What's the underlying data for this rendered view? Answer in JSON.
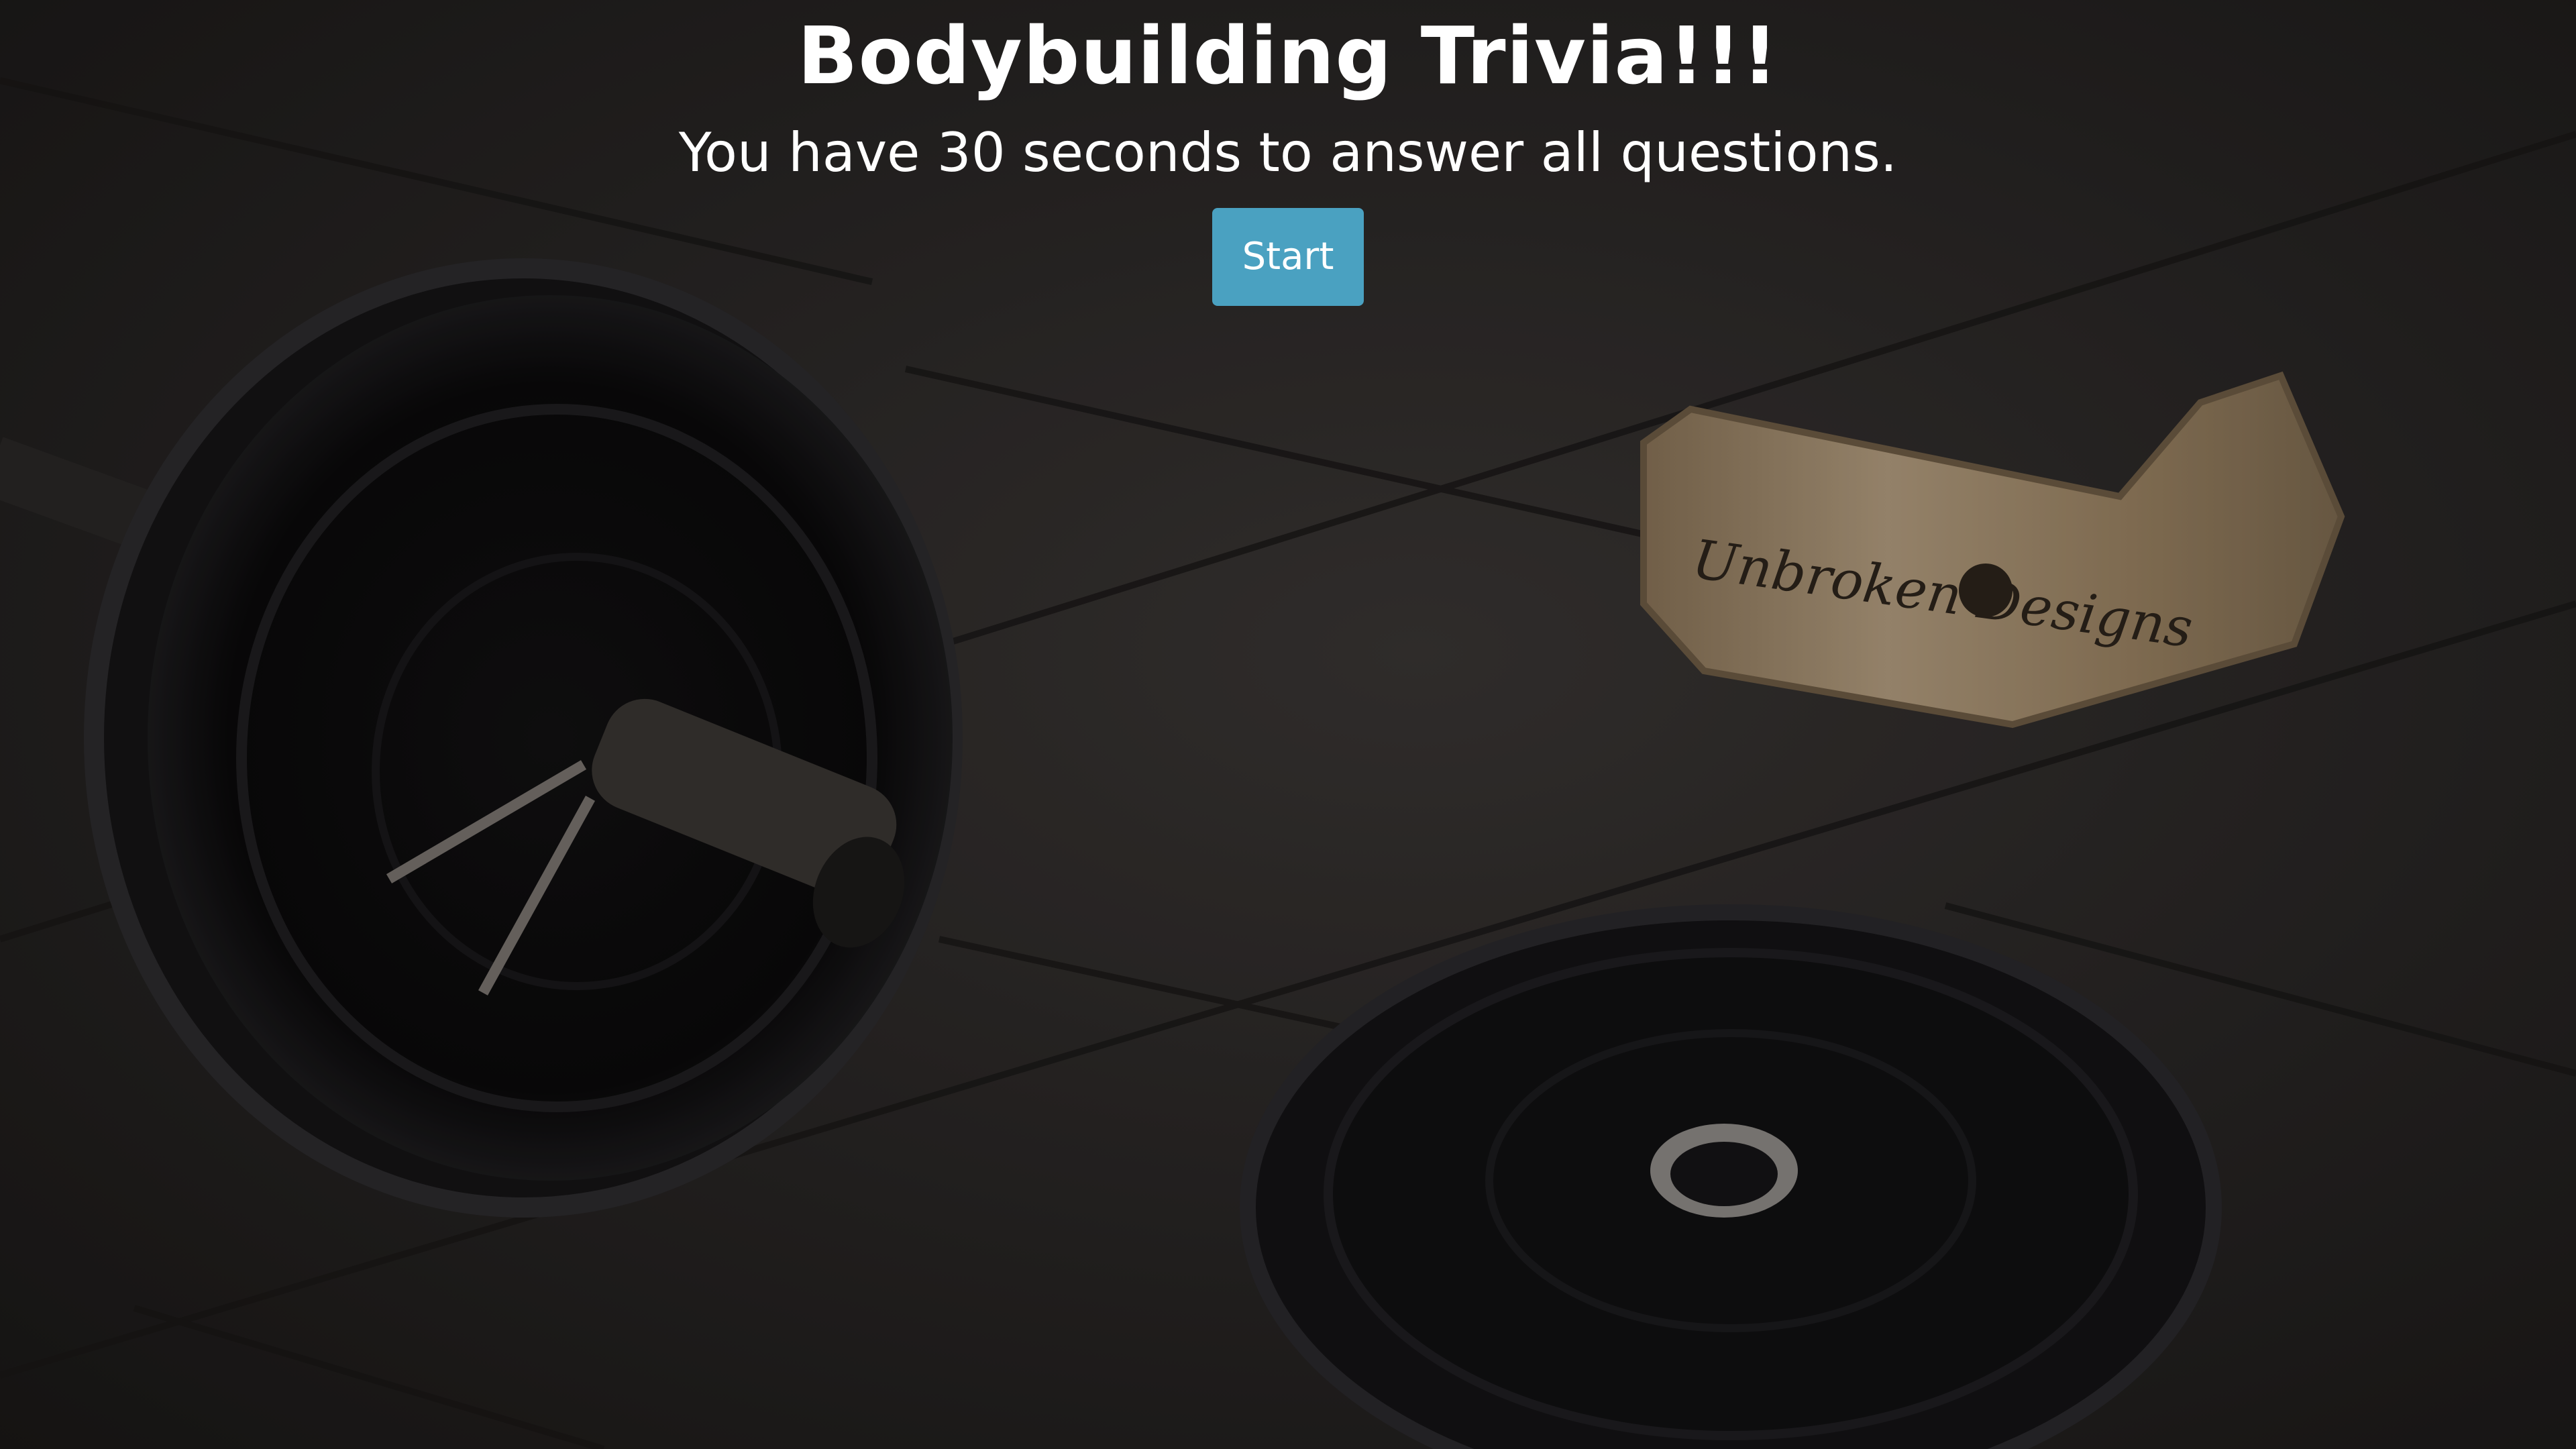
{
  "header": {
    "title": "Bodybuilding Trivia!!!",
    "subtitle": "You have 30 seconds to answer all questions."
  },
  "start_button": {
    "label": "Start"
  },
  "background": {
    "belt_text": "Unbroken Designs"
  },
  "colors": {
    "button": "#4aa1c1",
    "text": "#ffffff",
    "background": "#2b2827"
  }
}
